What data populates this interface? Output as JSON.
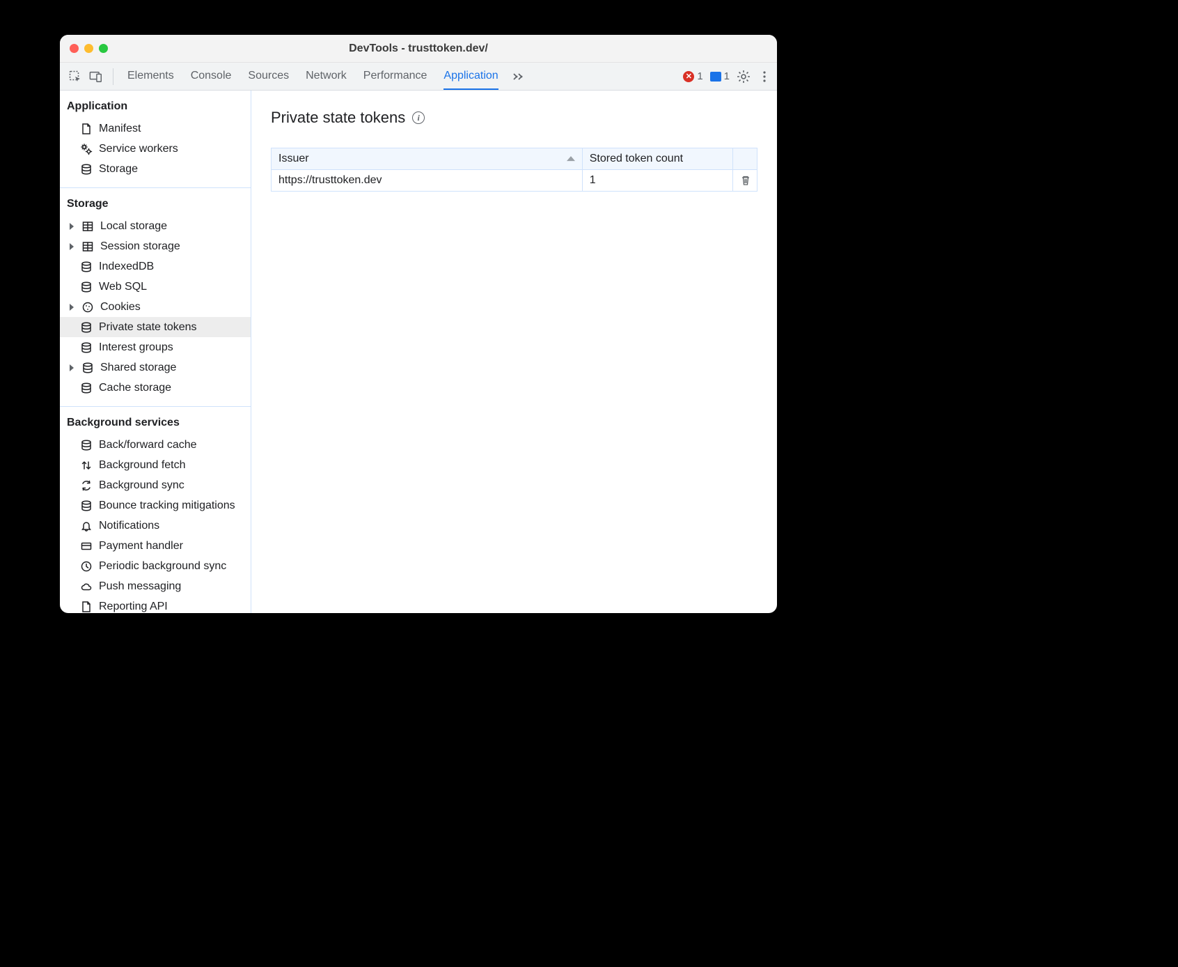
{
  "window": {
    "title": "DevTools - trusttoken.dev/"
  },
  "toolbar": {
    "tabs": [
      "Elements",
      "Console",
      "Sources",
      "Network",
      "Performance",
      "Application"
    ],
    "active_tab_index": 5,
    "errors_count": "1",
    "messages_count": "1"
  },
  "sidebar": {
    "sections": [
      {
        "title": "Application",
        "items": [
          {
            "label": "Manifest",
            "icon": "file-icon",
            "caret": false
          },
          {
            "label": "Service workers",
            "icon": "gears-icon",
            "caret": false
          },
          {
            "label": "Storage",
            "icon": "database-icon",
            "caret": false
          }
        ]
      },
      {
        "title": "Storage",
        "items": [
          {
            "label": "Local storage",
            "icon": "table-icon",
            "caret": true
          },
          {
            "label": "Session storage",
            "icon": "table-icon",
            "caret": true
          },
          {
            "label": "IndexedDB",
            "icon": "database-icon",
            "caret": false
          },
          {
            "label": "Web SQL",
            "icon": "database-icon",
            "caret": false
          },
          {
            "label": "Cookies",
            "icon": "cookie-icon",
            "caret": true
          },
          {
            "label": "Private state tokens",
            "icon": "database-icon",
            "caret": false,
            "selected": true
          },
          {
            "label": "Interest groups",
            "icon": "database-icon",
            "caret": false
          },
          {
            "label": "Shared storage",
            "icon": "database-icon",
            "caret": true
          },
          {
            "label": "Cache storage",
            "icon": "database-icon",
            "caret": false
          }
        ]
      },
      {
        "title": "Background services",
        "items": [
          {
            "label": "Back/forward cache",
            "icon": "database-icon",
            "caret": false
          },
          {
            "label": "Background fetch",
            "icon": "arrows-updown-icon",
            "caret": false
          },
          {
            "label": "Background sync",
            "icon": "sync-icon",
            "caret": false
          },
          {
            "label": "Bounce tracking mitigations",
            "icon": "database-icon",
            "caret": false
          },
          {
            "label": "Notifications",
            "icon": "bell-icon",
            "caret": false
          },
          {
            "label": "Payment handler",
            "icon": "card-icon",
            "caret": false
          },
          {
            "label": "Periodic background sync",
            "icon": "clock-icon",
            "caret": false
          },
          {
            "label": "Push messaging",
            "icon": "cloud-icon",
            "caret": false
          },
          {
            "label": "Reporting API",
            "icon": "file-icon",
            "caret": false
          }
        ]
      }
    ]
  },
  "content": {
    "heading": "Private state tokens",
    "columns": [
      "Issuer",
      "Stored token count"
    ],
    "rows": [
      {
        "issuer": "https://trusttoken.dev",
        "count": "1"
      }
    ]
  }
}
